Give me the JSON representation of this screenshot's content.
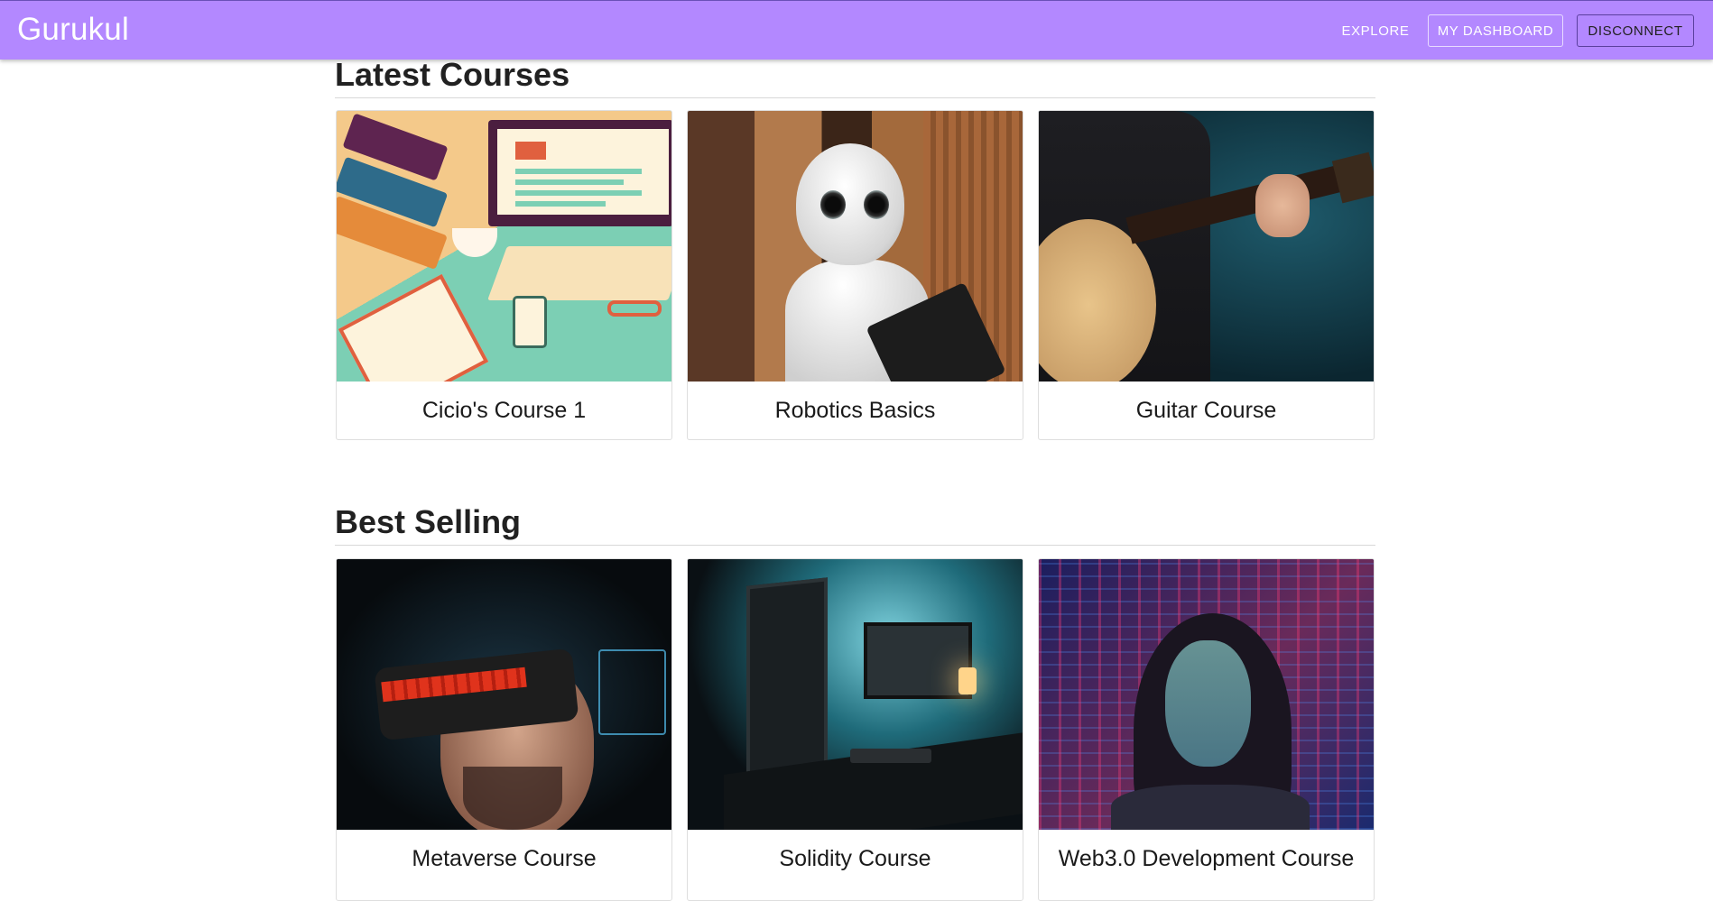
{
  "app": {
    "brand": "Gurukul",
    "colors": {
      "appbar": "#b388ff"
    }
  },
  "nav": {
    "explore": "EXPLORE",
    "dashboard": "MY DASHBOARD",
    "disconnect": "DISCONNECT"
  },
  "sections": {
    "latest": {
      "title": "Latest Courses",
      "courses": [
        {
          "title": "Cicio's Course 1",
          "image": "study-desk-illustration"
        },
        {
          "title": "Robotics Basics",
          "image": "humanoid-robot-photo"
        },
        {
          "title": "Guitar Course",
          "image": "acoustic-guitar-photo"
        }
      ]
    },
    "best": {
      "title": "Best Selling",
      "courses": [
        {
          "title": "Metaverse Course",
          "image": "vr-headset-photo"
        },
        {
          "title": "Solidity Course",
          "image": "computer-desk-setup-photo"
        },
        {
          "title": "Web3.0 Development Course",
          "image": "code-projection-portrait-photo"
        }
      ]
    }
  }
}
